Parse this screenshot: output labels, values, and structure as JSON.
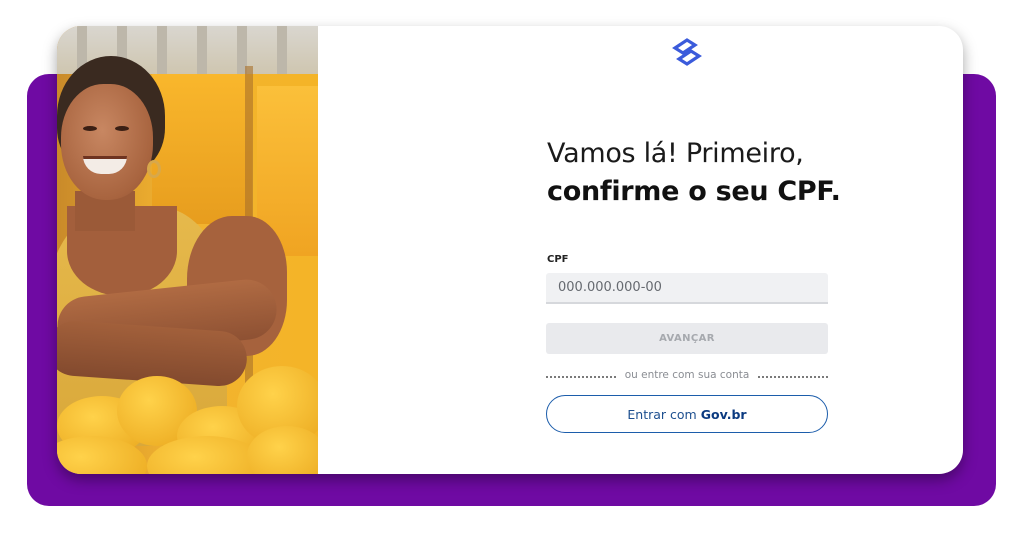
{
  "heading": {
    "line1": "Vamos lá! Primeiro,",
    "line2": "confirme o seu CPF."
  },
  "form": {
    "cpf_label": "CPF",
    "cpf_placeholder": "000.000.000-00",
    "cpf_value": "",
    "advance_label": "AVANÇAR"
  },
  "alt_login": {
    "divider_text": "ou entre com sua conta",
    "gov_prefix": "Entrar com",
    "gov_brand": "Gov.br"
  },
  "colors": {
    "frame_purple": "#6f0aa3",
    "brand_blue": "#3b5bdb",
    "gov_blue": "#1c5dab",
    "disabled_gray": "#e9eaed"
  },
  "icons": {
    "logo": "banco-do-brasil-logo"
  }
}
